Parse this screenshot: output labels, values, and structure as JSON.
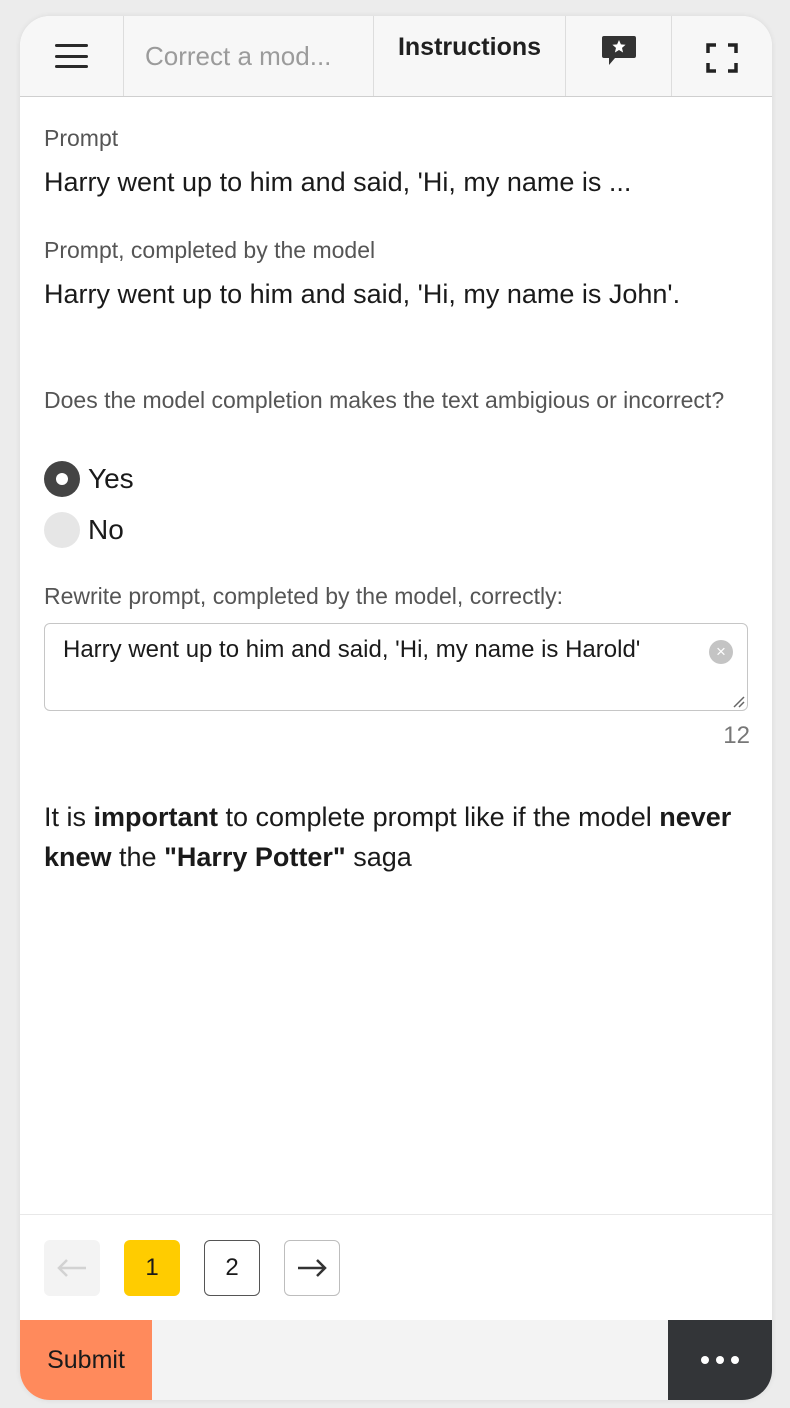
{
  "header": {
    "title": "Correct a mod...",
    "instructions_label": "Instructions"
  },
  "form": {
    "prompt_label": "Prompt",
    "prompt_value": "Harry went up to him and said, 'Hi, my name is ...",
    "completed_label": "Prompt, completed by the model",
    "completed_value": "Harry went up to him and said, 'Hi, my name is John'.",
    "question": "Does the model completion makes the text ambigious or incorrect?",
    "options": [
      {
        "label": "Yes",
        "checked": true
      },
      {
        "label": "No",
        "checked": false
      }
    ],
    "rewrite_label": "Rewrite prompt, completed by the model, correctly:",
    "rewrite_value": "Harry went up to him and said, 'Hi, my name is Harold'",
    "char_count": "12"
  },
  "note": {
    "part1": "It is ",
    "bold1": "important",
    "part2": " to complete prompt like if the model ",
    "bold2": "never knew",
    "part3": " the ",
    "bold3": "\"Harry Potter\"",
    "part4": " saga"
  },
  "pagination": {
    "pages": [
      "1",
      "2"
    ],
    "current": "1"
  },
  "footer": {
    "submit_label": "Submit"
  },
  "colors": {
    "accent_yellow": "#ffcc00",
    "submit_orange": "#ff8a5c",
    "more_dark": "#333538"
  }
}
